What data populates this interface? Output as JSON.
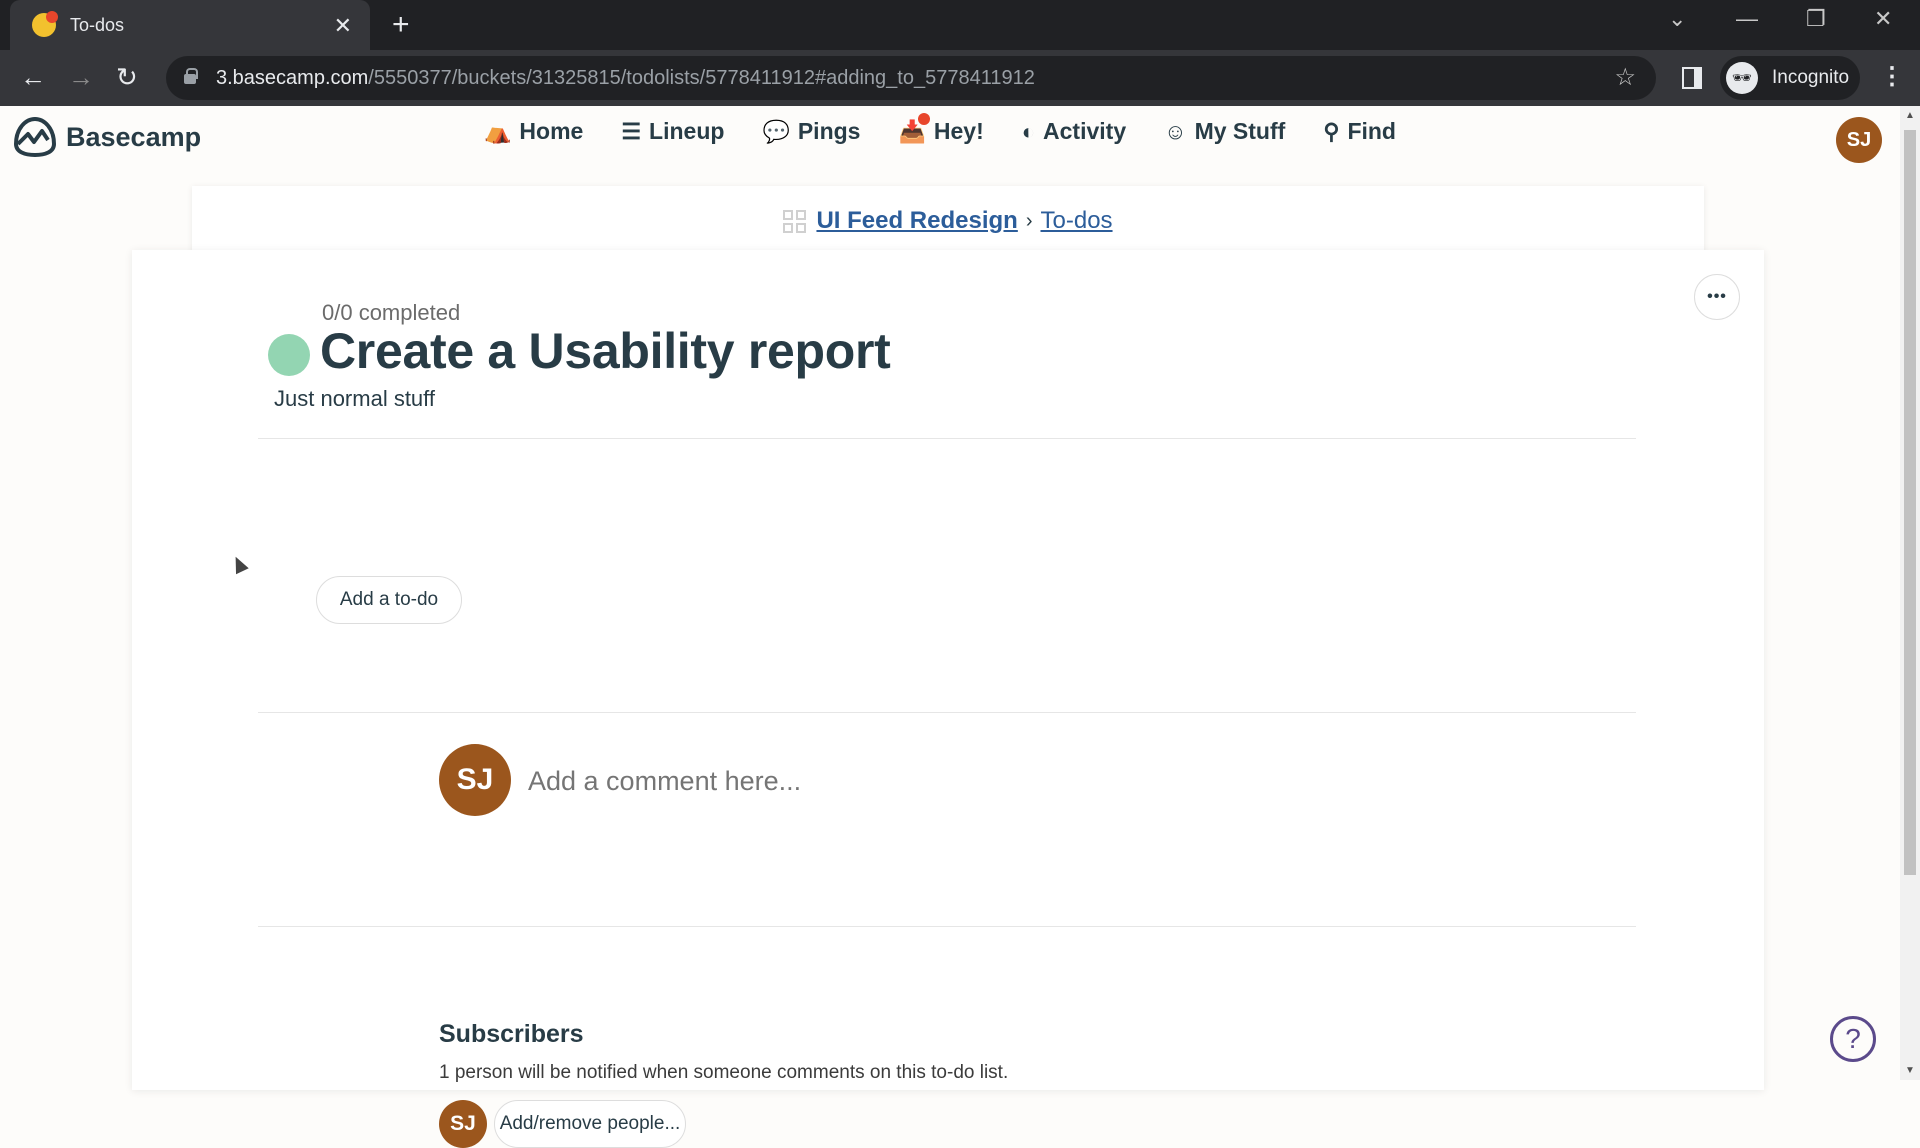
{
  "browser": {
    "tab_title": "To-dos",
    "tab_close": "✕",
    "new_tab": "+",
    "url_host": "3.basecamp.com",
    "url_path": "/5550377/buckets/31325815/todolists/5778411912#adding_to_5778411912",
    "profile_label": "Incognito",
    "controls": {
      "dropdown": "⌄",
      "minimize": "—",
      "restore": "❐",
      "close": "✕"
    },
    "nav": {
      "back": "←",
      "forward": "→",
      "reload": "↻"
    },
    "star": "☆",
    "menu": "⋮"
  },
  "app": {
    "brand": "Basecamp",
    "nav": [
      {
        "label": "Home",
        "icon": "⛺"
      },
      {
        "label": "Lineup",
        "icon": "☰"
      },
      {
        "label": "Pings",
        "icon": "💬"
      },
      {
        "label": "Hey!",
        "icon": "📥"
      },
      {
        "label": "Activity",
        "icon": "◐"
      },
      {
        "label": "My Stuff",
        "icon": "☺"
      },
      {
        "label": "Find",
        "icon": "⚲"
      }
    ],
    "user_initials": "SJ",
    "hey_badge_color": "#e8462b"
  },
  "breadcrumb": {
    "project": "UI Feed Redesign",
    "separator": "›",
    "section": "To-dos"
  },
  "todolist": {
    "completed": "0/0 completed",
    "title": "Create a Usability report",
    "description": "Just normal stuff",
    "status_color": "#93d5b2",
    "add_todo_label": "Add a to-do",
    "more_label": "•••"
  },
  "comment": {
    "avatar_initials": "SJ",
    "placeholder": "Add a comment here..."
  },
  "subscribers": {
    "title": "Subscribers",
    "description": "1 person will be notified when someone comments on this to-do list.",
    "avatar_initials": "SJ",
    "add_remove_label": "Add/remove people..."
  },
  "help": {
    "label": "?"
  }
}
